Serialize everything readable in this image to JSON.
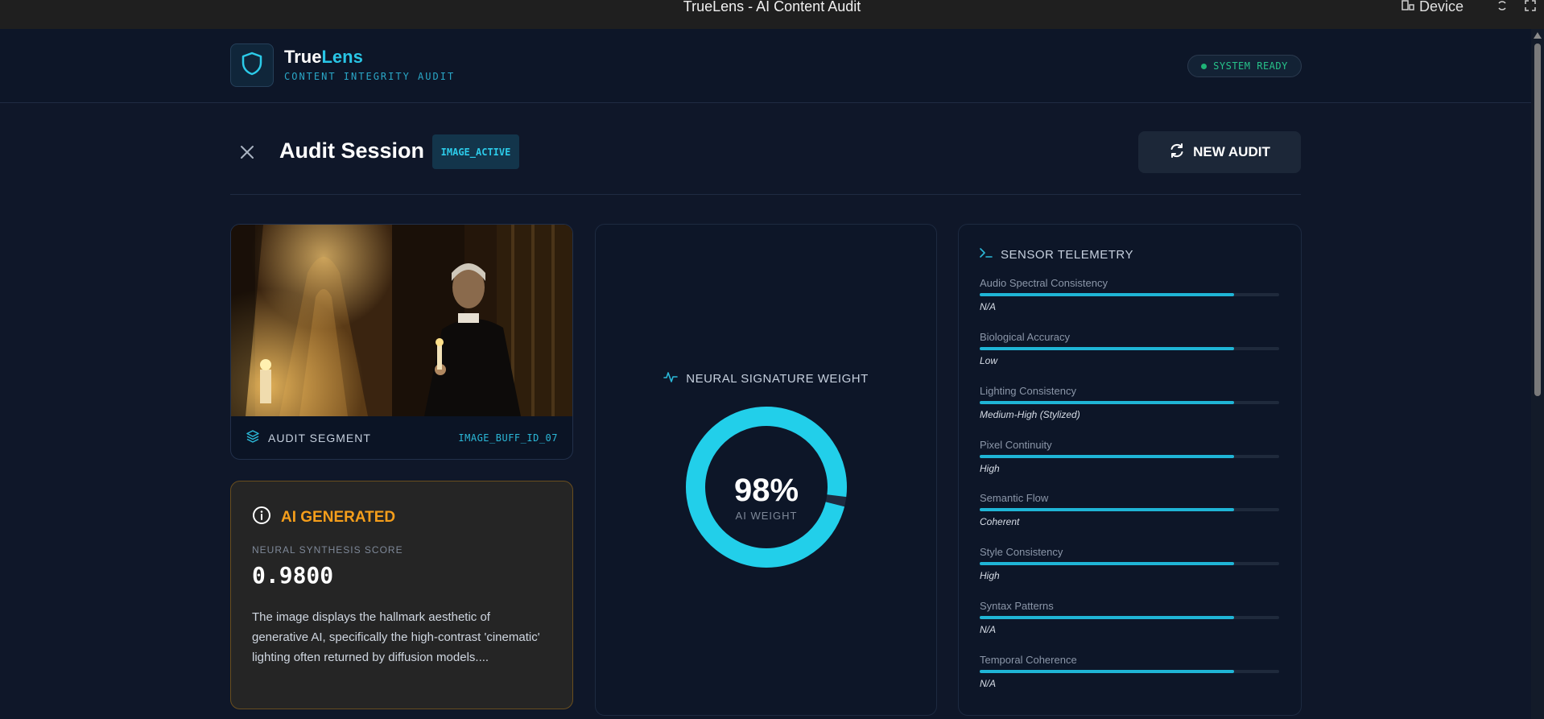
{
  "window": {
    "title": "TrueLens - AI Content Audit",
    "device_label": "Device"
  },
  "header": {
    "brand_primary": "True",
    "brand_accent": "Lens",
    "brand_subtitle": "CONTENT INTEGRITY AUDIT",
    "status": "SYSTEM READY"
  },
  "session": {
    "title": "Audit Session",
    "badge": "IMAGE_ACTIVE",
    "new_audit_label": "NEW AUDIT"
  },
  "media": {
    "segment_label": "AUDIT SEGMENT",
    "segment_id": "IMAGE_BUFF_ID_07"
  },
  "verdict": {
    "label": "AI GENERATED",
    "score_label": "NEURAL SYNTHESIS SCORE",
    "score_value": "0.9800",
    "description": "The image displays the hallmark aesthetic of generative AI, specifically the high-contrast 'cinematic' lighting often returned by diffusion models...."
  },
  "neural": {
    "title": "NEURAL SIGNATURE WEIGHT",
    "value_text": "98%",
    "value": 0.98,
    "sub_label": "AI WEIGHT"
  },
  "telemetry": {
    "title": "SENSOR TELEMETRY",
    "metrics": [
      {
        "name": "Audio Spectral Consistency",
        "value": "N/A",
        "level": 0.85
      },
      {
        "name": "Biological Accuracy",
        "value": "Low",
        "level": 0.85
      },
      {
        "name": "Lighting Consistency",
        "value": "Medium-High (Stylized)",
        "level": 0.85
      },
      {
        "name": "Pixel Continuity",
        "value": "High",
        "level": 0.85
      },
      {
        "name": "Semantic Flow",
        "value": "Coherent",
        "level": 0.85
      },
      {
        "name": "Style Consistency",
        "value": "High",
        "level": 0.85
      },
      {
        "name": "Syntax Patterns",
        "value": "N/A",
        "level": 0.85
      },
      {
        "name": "Temporal Coherence",
        "value": "N/A",
        "level": 0.85
      }
    ]
  },
  "colors": {
    "accent": "#29c6e6",
    "warning": "#f59e1b",
    "success": "#1fb377",
    "background": "#0f1729"
  },
  "icons": {
    "logo": "shield-icon",
    "close": "close-icon",
    "refresh": "refresh-icon",
    "layers": "layers-icon",
    "info": "info-icon",
    "activity": "activity-icon",
    "terminal": "terminal-icon"
  }
}
